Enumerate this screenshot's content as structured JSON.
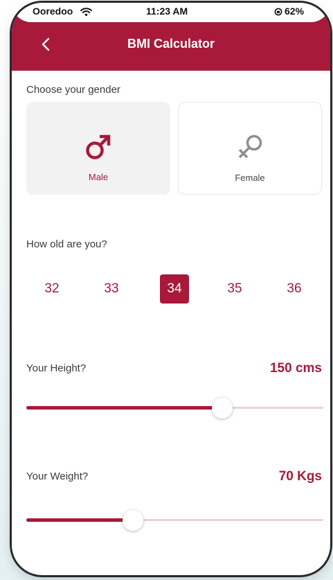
{
  "status_bar": {
    "carrier": "Ooredoo",
    "time": "11:23 AM",
    "battery": "62%"
  },
  "header": {
    "title": "BMI Calculator",
    "back_icon": "chevron-left-icon"
  },
  "gender": {
    "label": "Choose your gender",
    "options": [
      {
        "label": "Male",
        "icon": "male-icon",
        "selected": true
      },
      {
        "label": "Female",
        "icon": "female-icon",
        "selected": false
      }
    ]
  },
  "age": {
    "label": "How old are you?",
    "options": [
      "32",
      "33",
      "34",
      "35",
      "36"
    ],
    "selected": "34"
  },
  "height": {
    "label": "Your Height?",
    "value": "150 cms",
    "slider_fraction": 0.66
  },
  "weight": {
    "label": "Your Weight?",
    "value": "70 Kgs",
    "slider_fraction": 0.36
  },
  "colors": {
    "accent": "#a8193a",
    "track": "#f1cfd7",
    "card_selected": "#f2f2f2"
  }
}
